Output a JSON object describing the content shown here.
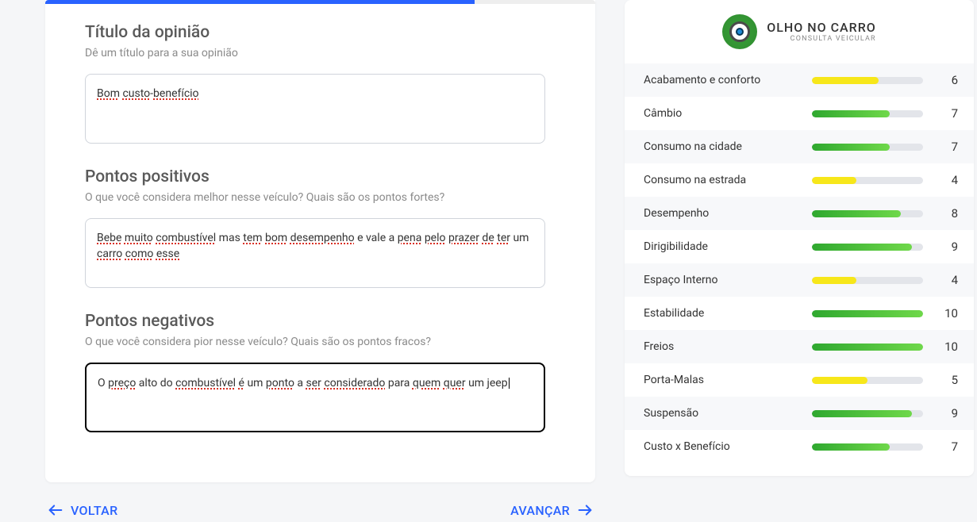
{
  "progress_pct": 78,
  "form": {
    "title_section": {
      "heading": "Título da opinião",
      "sub": "Dê um título para a sua opinião",
      "value_parts": [
        {
          "t": "Bom",
          "err": true
        },
        {
          "t": " ",
          "err": false
        },
        {
          "t": "custo",
          "err": true
        },
        {
          "t": "-",
          "err": false
        },
        {
          "t": "benefício",
          "err": true
        }
      ]
    },
    "pros_section": {
      "heading": "Pontos positivos",
      "sub": "O que você considera melhor nesse veículo? Quais são os pontos fortes?",
      "value_parts": [
        {
          "t": "Bebe",
          "err": true
        },
        {
          "t": " ",
          "err": false
        },
        {
          "t": "muito",
          "err": true
        },
        {
          "t": " ",
          "err": false
        },
        {
          "t": "combustível",
          "err": true
        },
        {
          "t": " mas ",
          "err": false
        },
        {
          "t": "tem",
          "err": true
        },
        {
          "t": " ",
          "err": false
        },
        {
          "t": "bom",
          "err": true
        },
        {
          "t": " ",
          "err": false
        },
        {
          "t": "desempenho",
          "err": true
        },
        {
          "t": " e vale a ",
          "err": false
        },
        {
          "t": "pena",
          "err": true
        },
        {
          "t": " ",
          "err": false
        },
        {
          "t": "pelo",
          "err": true
        },
        {
          "t": " ",
          "err": false
        },
        {
          "t": "prazer",
          "err": true
        },
        {
          "t": " ",
          "err": false
        },
        {
          "t": "de",
          "err": true
        },
        {
          "t": " ",
          "err": false
        },
        {
          "t": "ter",
          "err": true
        },
        {
          "t": " um ",
          "err": false
        },
        {
          "t": "carro",
          "err": true
        },
        {
          "t": " ",
          "err": false
        },
        {
          "t": "como",
          "err": true
        },
        {
          "t": " ",
          "err": false
        },
        {
          "t": "esse",
          "err": true
        }
      ]
    },
    "cons_section": {
      "heading": "Pontos negativos",
      "sub": "O que você considera pior nesse veículo? Quais são os pontos fracos?",
      "value_parts": [
        {
          "t": "O ",
          "err": false
        },
        {
          "t": "preço",
          "err": true
        },
        {
          "t": " alto do ",
          "err": false
        },
        {
          "t": "combustível",
          "err": true
        },
        {
          "t": " ",
          "err": false
        },
        {
          "t": "é",
          "err": true
        },
        {
          "t": " um ",
          "err": false
        },
        {
          "t": "ponto",
          "err": true
        },
        {
          "t": " a ",
          "err": false
        },
        {
          "t": "ser",
          "err": true
        },
        {
          "t": " ",
          "err": false
        },
        {
          "t": "considerado",
          "err": true
        },
        {
          "t": " para ",
          "err": false
        },
        {
          "t": "quem",
          "err": true
        },
        {
          "t": " ",
          "err": false
        },
        {
          "t": "quer",
          "err": true
        },
        {
          "t": " um jeep",
          "err": false
        }
      ],
      "caret": true
    }
  },
  "nav": {
    "back": "VOLTAR",
    "next": "AVANÇAR"
  },
  "brand": {
    "line1": "OLHO NO CARRO",
    "line2": "CONSULTA VEICULAR"
  },
  "ratings": [
    {
      "label": "Acabamento e conforto",
      "value": 6,
      "color": "yellow"
    },
    {
      "label": "Câmbio",
      "value": 7,
      "color": "green"
    },
    {
      "label": "Consumo na cidade",
      "value": 7,
      "color": "green"
    },
    {
      "label": "Consumo na estrada",
      "value": 4,
      "color": "yellow"
    },
    {
      "label": "Desempenho",
      "value": 8,
      "color": "green"
    },
    {
      "label": "Dirigibilidade",
      "value": 9,
      "color": "green"
    },
    {
      "label": "Espaço Interno",
      "value": 4,
      "color": "yellow"
    },
    {
      "label": "Estabilidade",
      "value": 10,
      "color": "green"
    },
    {
      "label": "Freios",
      "value": 10,
      "color": "green"
    },
    {
      "label": "Porta-Malas",
      "value": 5,
      "color": "yellow"
    },
    {
      "label": "Suspensão",
      "value": 9,
      "color": "green"
    },
    {
      "label": "Custo x Benefício",
      "value": 7,
      "color": "green"
    }
  ],
  "colors": {
    "yellow": "linear-gradient(90deg,#f7e71a,#f7e71a)",
    "green": "linear-gradient(90deg,#2fa82f,#6fd84a)"
  }
}
